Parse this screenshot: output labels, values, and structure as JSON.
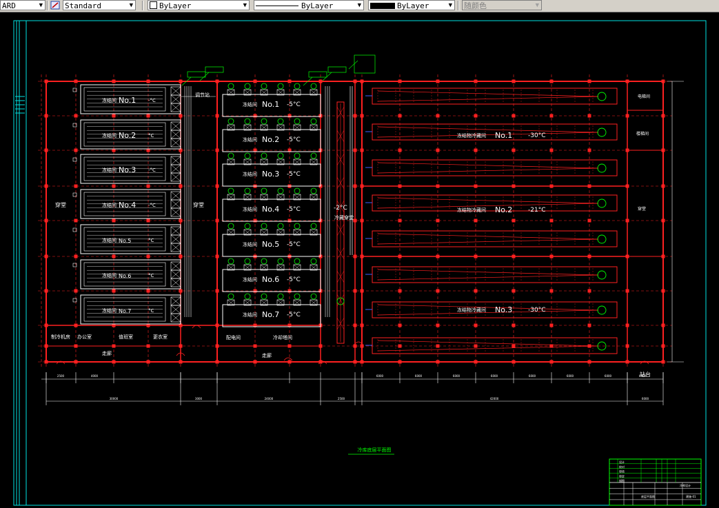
{
  "toolbar": {
    "text_style": "ARD",
    "dim_style": "Standard",
    "layer": "ByLayer",
    "linetype": "ByLayer",
    "lineweight": "ByLayer",
    "plot_style": "随颜色"
  },
  "drawing": {
    "colors": {
      "wall": "#ff2020",
      "text": "#ffffff",
      "frame": "#00e5e5",
      "equip": "#00ff00"
    },
    "rooms_left": [
      {
        "name": "冻结间",
        "no": "No.1",
        "temp": "-°C"
      },
      {
        "name": "冻结间",
        "no": "No.2",
        "temp": "°C"
      },
      {
        "name": "冻结间",
        "no": "No.3",
        "temp": "-°C"
      },
      {
        "name": "冻结间",
        "no": "No.4",
        "temp": "-°C"
      },
      {
        "name": "冻结间",
        "no": "No.5",
        "temp": "°C"
      },
      {
        "name": "冻结间",
        "no": "No.6",
        "temp": "°C"
      },
      {
        "name": "冻结间",
        "no": "No.7",
        "temp": "°C"
      }
    ],
    "rooms_mid": [
      {
        "name": "冻结间",
        "no": "No.1",
        "temp": "-5°C"
      },
      {
        "name": "冻结间",
        "no": "No.2",
        "temp": "-5°C"
      },
      {
        "name": "冻结间",
        "no": "No.3",
        "temp": "-5°C"
      },
      {
        "name": "冻结间",
        "no": "No.4",
        "temp": "-5°C"
      },
      {
        "name": "冻结间",
        "no": "No.5",
        "temp": "-5°C"
      },
      {
        "name": "冻结间",
        "no": "No.6",
        "temp": "-5°C"
      },
      {
        "name": "冻结间",
        "no": "No.7",
        "temp": "-5°C"
      }
    ],
    "rooms_right": [
      {
        "name": "冻结物冷藏间",
        "no": "No.1",
        "temp": "-30°C"
      },
      {
        "name": "冻结物冷藏间",
        "no": "No.2",
        "temp": "-21°C"
      },
      {
        "name": "冻结物冷藏间",
        "no": "No.3",
        "temp": "-30°C"
      }
    ],
    "labels": {
      "left_corridor": "穿堂",
      "mid_corridor": "穿堂",
      "left_top": "调节站",
      "corridor_temp": "-2°C",
      "corridor_name": "冷藏穿堂",
      "bottom_rooms_left": [
        "制冷机房",
        "办公室",
        "值班室",
        "更衣室"
      ],
      "walkway_left": "走廊",
      "bottom_rooms_mid": [
        "配电间",
        "冷却塔间"
      ],
      "walkway_mid": "走廊",
      "right_side_1": "电梯间",
      "right_side_2": "楼梯间",
      "right_side_3": "穿堂",
      "platform": "站台",
      "drawing_title": "冷库底层平面图"
    },
    "dims_top": [
      "2500",
      "4000",
      "6000",
      "6000",
      "6000",
      "6000",
      "6000",
      "6000",
      "6000",
      "6000",
      "3000"
    ],
    "dims_bottom": [
      "30000",
      "3000",
      "24000",
      "2500",
      "42000",
      "6000"
    ],
    "title_block": {
      "rows": [
        "设计",
        "校对",
        "审核",
        "审定",
        "描图"
      ],
      "project": "冷库设计",
      "drawing": "底层平面图",
      "sheet": "建施-01"
    }
  }
}
